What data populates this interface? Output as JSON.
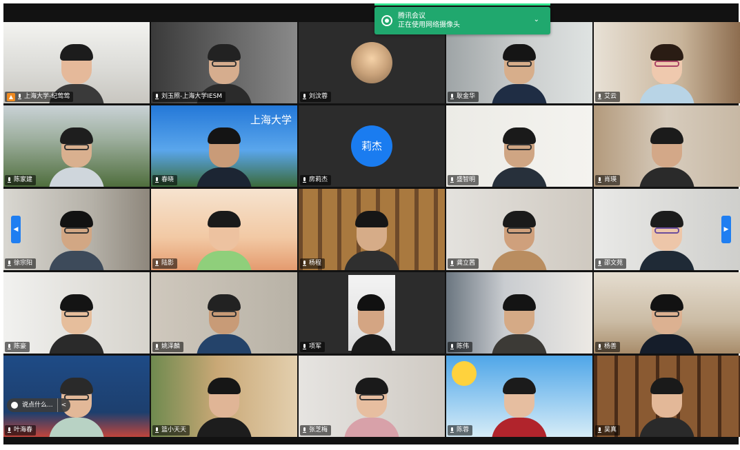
{
  "notification": {
    "app": "腾讯会议",
    "message": "正在使用网络摄像头",
    "chevron": "⌄"
  },
  "participants": [
    {
      "name": "上海大学-纪莺莺",
      "host": true
    },
    {
      "name": "刘玉照-上海大学IESM"
    },
    {
      "name": "刘汶蓉"
    },
    {
      "name": "耿金华"
    },
    {
      "name": "艾云"
    },
    {
      "name": "陈家建"
    },
    {
      "name": "春晓"
    },
    {
      "name": "房莉杰",
      "avatar_text": "莉杰"
    },
    {
      "name": "盛智明"
    },
    {
      "name": "肖瑛"
    },
    {
      "name": "徐宗阳"
    },
    {
      "name": "陆影"
    },
    {
      "name": "杨程"
    },
    {
      "name": "龚立茜"
    },
    {
      "name": "邵文苑"
    },
    {
      "name": "陈豪"
    },
    {
      "name": "姚泽麟"
    },
    {
      "name": "项军"
    },
    {
      "name": "陈伟"
    },
    {
      "name": "杨善"
    },
    {
      "name": "叶海春"
    },
    {
      "name": "篮小天天"
    },
    {
      "name": "张芝梅"
    },
    {
      "name": "陈蓉"
    },
    {
      "name": "吴真"
    }
  ],
  "slide_text": {
    "university": "上海大学"
  },
  "caption_pill": {
    "text": "说点什么...",
    "back": "<"
  },
  "nav": {
    "left": "◀",
    "right": "▶"
  },
  "colors": {
    "notification": "#20a86e",
    "avatar": "#1a7cf0",
    "host_badge": "#f08b21",
    "nav_arrow": "#1f7ef1"
  }
}
